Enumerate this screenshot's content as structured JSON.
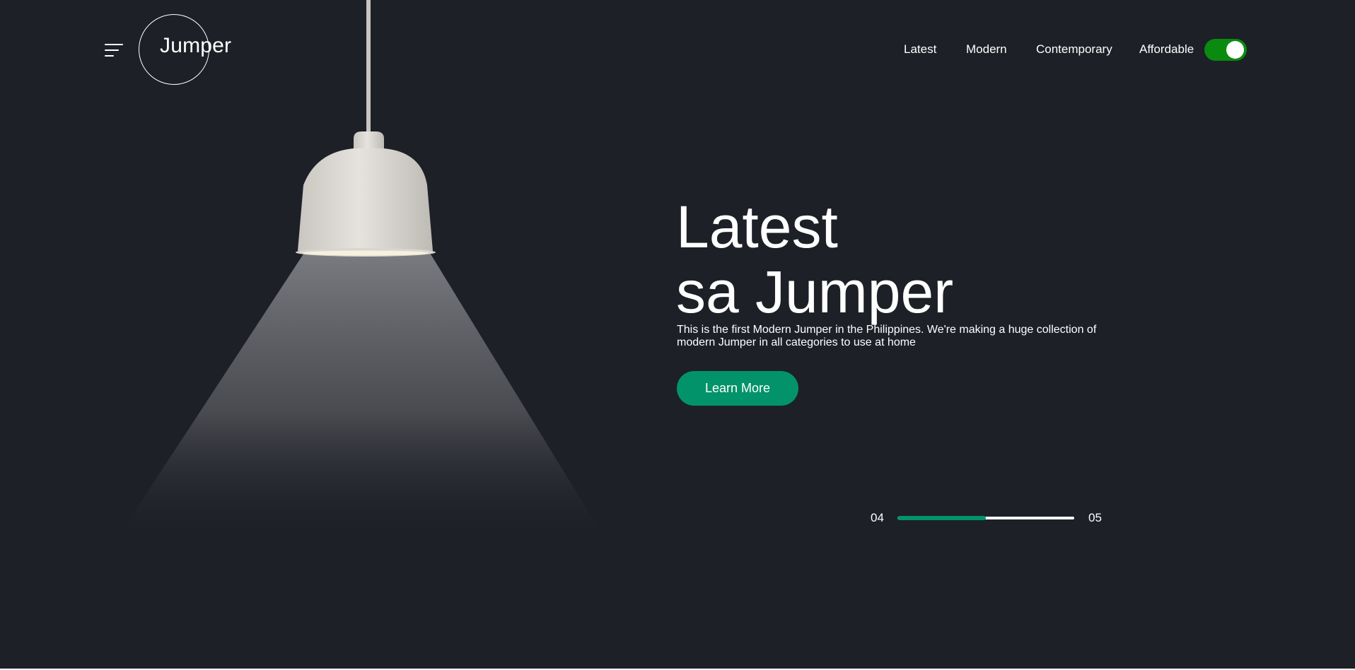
{
  "header": {
    "logo_text": "Jumper",
    "nav": [
      {
        "label": "Latest"
      },
      {
        "label": "Modern"
      },
      {
        "label": "Contemporary"
      },
      {
        "label": "Affordable"
      }
    ],
    "theme_toggle_on": true
  },
  "hero": {
    "title_line1": "Latest",
    "title_line2": "sa Jumper",
    "description": "This is the first Modern Jumper in the Philippines. We're making a huge collection of modern Jumper in all categories to use at home",
    "cta_label": "Learn More"
  },
  "slider": {
    "current": "04",
    "total": "05",
    "progress_fraction": 0.5
  },
  "colors": {
    "background": "#1d2027",
    "accent": "#03936a",
    "toggle": "#0a8a0f",
    "text": "#ffffff"
  }
}
